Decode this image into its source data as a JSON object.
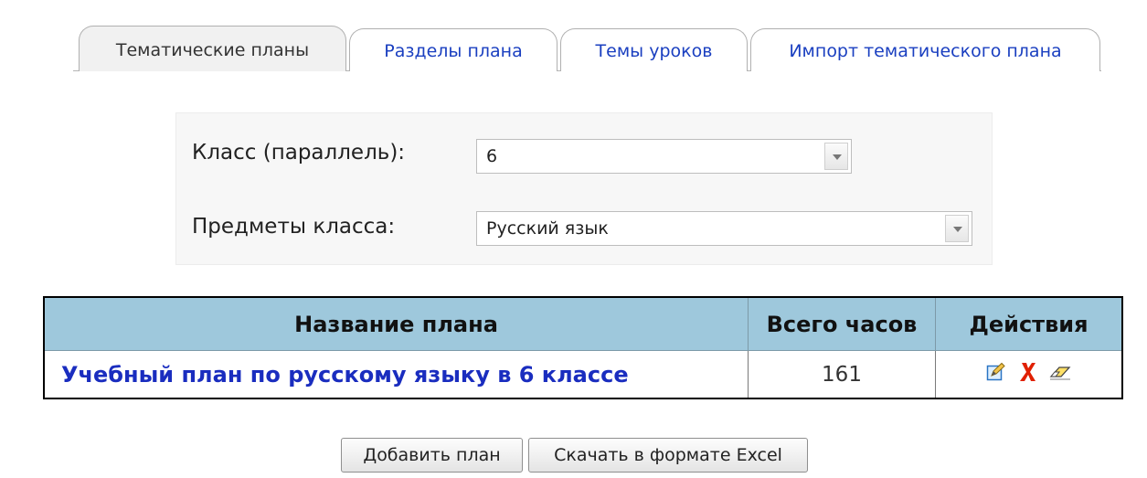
{
  "tabs": [
    {
      "label": "Тематические планы",
      "active": true
    },
    {
      "label": "Разделы плана",
      "active": false
    },
    {
      "label": "Темы уроков",
      "active": false
    },
    {
      "label": "Импорт тематического плана",
      "active": false
    }
  ],
  "filters": {
    "class_label": "Класс (параллель):",
    "class_value": "6",
    "subject_label": "Предметы класса:",
    "subject_value": "Русский язык"
  },
  "table": {
    "headers": [
      "Название плана",
      "Всего часов",
      "Действия"
    ],
    "rows": [
      {
        "name": "Учебный план по русскому языку в 6 классе",
        "hours": "161",
        "actions": [
          "edit-icon",
          "delete-icon",
          "clear-icon"
        ]
      }
    ]
  },
  "buttons": {
    "add_plan": "Добавить план",
    "download_excel": "Скачать в формате Excel"
  },
  "colors": {
    "link": "#1a2dbf",
    "header_bg": "#9ec8dc",
    "active_tab_bg": "#f1f1f1",
    "delete": "#e02000"
  }
}
